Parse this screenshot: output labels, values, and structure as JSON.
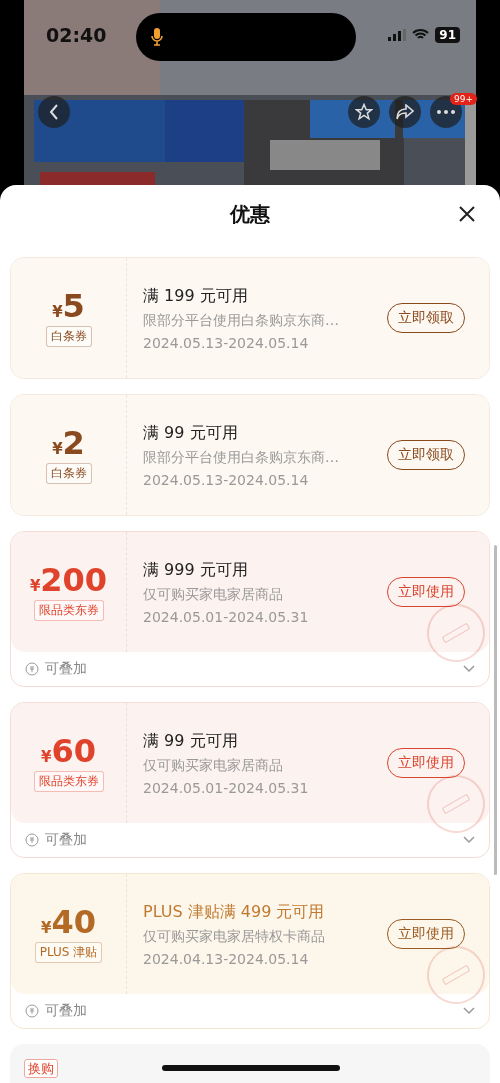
{
  "status_bar": {
    "time": "02:40",
    "battery": "91"
  },
  "nav": {
    "badge": "99+"
  },
  "sheet": {
    "title": "优惠"
  },
  "coupons": [
    {
      "kind": "baitiao",
      "currency": "¥",
      "amount": "5",
      "tag": "白条券",
      "title": "满 199 元可用",
      "desc": "限部分平台使用白条购京东商…",
      "dates": "2024.05.13-2024.05.14",
      "action": "立即领取",
      "claimed": false
    },
    {
      "kind": "baitiao",
      "currency": "¥",
      "amount": "2",
      "tag": "白条券",
      "title": "满 99 元可用",
      "desc": "限部分平台使用白条购京东商…",
      "dates": "2024.05.13-2024.05.14",
      "action": "立即领取",
      "claimed": false
    },
    {
      "kind": "category",
      "currency": "¥",
      "amount": "200",
      "tag": "限品类东券",
      "title": "满 999 元可用",
      "desc": "仅可购买家电家居商品",
      "dates": "2024.05.01-2024.05.31",
      "action": "立即使用",
      "claimed": true,
      "footer": "可叠加"
    },
    {
      "kind": "category",
      "currency": "¥",
      "amount": "60",
      "tag": "限品类东券",
      "title": "满 99 元可用",
      "desc": "仅可购买家电家居商品",
      "dates": "2024.05.01-2024.05.31",
      "action": "立即使用",
      "claimed": true,
      "footer": "可叠加"
    },
    {
      "kind": "plus",
      "currency": "¥",
      "amount": "40",
      "tag": "PLUS 津贴",
      "title": "PLUS 津贴满 499 元可用",
      "desc": "仅可购买家电家居特权卡商品",
      "dates": "2024.04.13-2024.05.14",
      "action": "立即使用",
      "claimed": true,
      "footer": "可叠加"
    }
  ],
  "partial_card": {
    "tag": "换购"
  }
}
